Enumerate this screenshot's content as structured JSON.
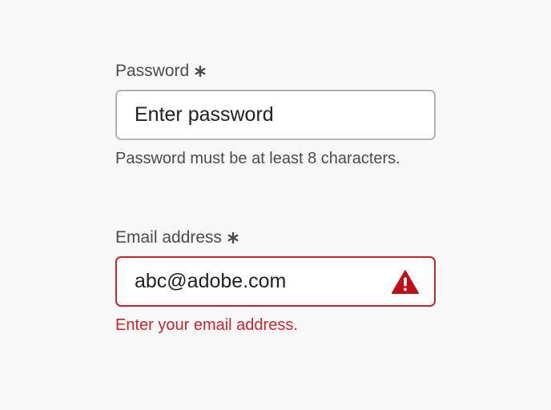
{
  "password_field": {
    "label": "Password",
    "input_value": "Enter password",
    "help_text": "Password must be at least 8 characters."
  },
  "email_field": {
    "label": "Email address",
    "input_value": "abc@adobe.com",
    "error_text": "Enter your email address."
  },
  "icons": {
    "required": "asterisk-icon",
    "invalid": "alert-triangle-icon"
  },
  "colors": {
    "background": "#f8f8f8",
    "label_text": "#4b4b4b",
    "field_border": "#b3b3b3",
    "error": "#c9252d",
    "input_text": "#222222"
  }
}
